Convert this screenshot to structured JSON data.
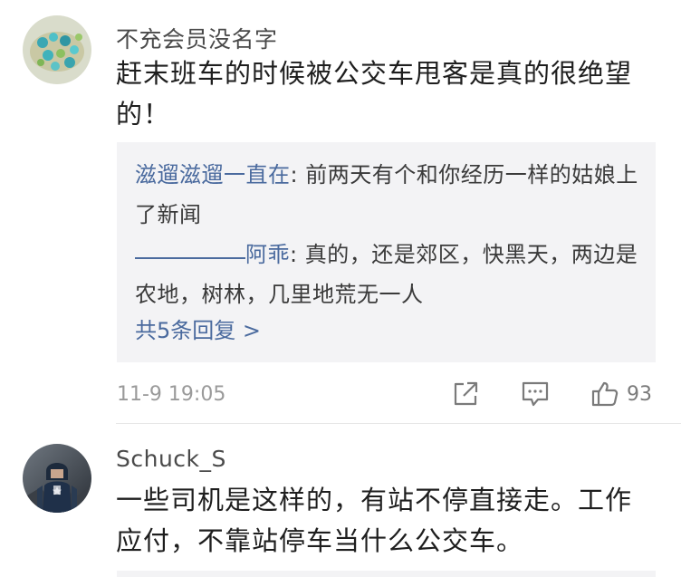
{
  "comments": [
    {
      "username": "不充会员没名字",
      "body": "赶末班车的时候被公交车甩客是真的很绝望的！",
      "avatar_icon": "bottle-caps-avatar",
      "replies": [
        {
          "name": "滋遛滋遛一直在",
          "sep": ": ",
          "text": "前两天有个和你经历一样的姑娘上了新闻"
        },
        {
          "name": "阿乖",
          "sep": ": ",
          "text": "真的，还是郊区，快黑天，两边是农地，树林，几里地荒无一人"
        }
      ],
      "more_replies": "共5条回复 >",
      "timestamp": "11-9 19:05",
      "like_count": "93"
    },
    {
      "username": "Schuck_S",
      "body": "一些司机是这样的，有站不停直接走。工作应付，不靠站停车当什么公交车。",
      "avatar_icon": "captain-america-avatar"
    }
  ],
  "icons": {
    "share": "share-icon",
    "comment": "comment-icon",
    "like": "thumbs-up-icon"
  },
  "colors": {
    "link": "#4a6a9e",
    "reply_bg": "#f3f3f5",
    "meta_text": "#9a9a9a"
  }
}
